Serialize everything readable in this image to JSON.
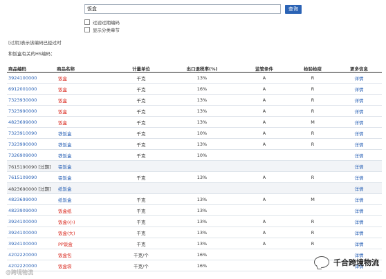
{
  "search": {
    "value": "饭盒",
    "button": "查询"
  },
  "options": [
    {
      "label": "过滤过期编码"
    },
    {
      "label": "显示分类章节"
    }
  ],
  "notes": {
    "expired_prefix": "[过期]",
    "expired_text": "表示该编码已经过时",
    "related": "和饭盒有关的HS编码："
  },
  "columns": [
    "商品编码",
    "商品名称",
    "计量单位",
    "出口退税率(%)",
    "监管条件",
    "检验检疫",
    "更多信息"
  ],
  "rows": [
    {
      "code": "3924100000",
      "name": "饭盒",
      "unit": "千克",
      "rate": "13%",
      "cond": "A",
      "insp": "R",
      "more": "详情",
      "name_color": "red",
      "code_link": true
    },
    {
      "code": "6912001000",
      "name": "饭盒",
      "unit": "千克",
      "rate": "16%",
      "cond": "A",
      "insp": "R",
      "more": "详情",
      "name_color": "red",
      "code_link": true
    },
    {
      "code": "7323930000",
      "name": "饭盒",
      "unit": "千克",
      "rate": "13%",
      "cond": "A",
      "insp": "R",
      "more": "详情",
      "name_color": "red",
      "code_link": true
    },
    {
      "code": "7323990000",
      "name": "饭盒",
      "unit": "千克",
      "rate": "13%",
      "cond": "A",
      "insp": "R",
      "more": "详情",
      "name_color": "red",
      "code_link": true
    },
    {
      "code": "4823699000",
      "name": "饭盒",
      "unit": "千克",
      "rate": "13%",
      "cond": "A",
      "insp": "M",
      "more": "详情",
      "name_color": "red",
      "code_link": true
    },
    {
      "code": "7323910090",
      "name": "铁饭盒",
      "unit": "千克",
      "rate": "10%",
      "cond": "A",
      "insp": "R",
      "more": "详情",
      "name_color": "blue",
      "code_link": true
    },
    {
      "code": "7323990000",
      "name": "铁饭盒",
      "unit": "千克",
      "rate": "13%",
      "cond": "A",
      "insp": "R",
      "more": "详情",
      "name_color": "blue",
      "code_link": true
    },
    {
      "code": "7326909000",
      "name": "铁饭盒",
      "unit": "千克",
      "rate": "10%",
      "cond": "",
      "insp": "",
      "more": "详情",
      "name_color": "blue",
      "code_link": true
    },
    {
      "code": "7615190090 [过期]",
      "name": "铝饭盒",
      "unit": "",
      "rate": "",
      "cond": "",
      "insp": "",
      "more": "详情",
      "name_color": "blue",
      "code_link": false
    },
    {
      "code": "7615109090",
      "name": "铝饭盒",
      "unit": "千克",
      "rate": "13%",
      "cond": "A",
      "insp": "R",
      "more": "详情",
      "name_color": "blue",
      "code_link": true
    },
    {
      "code": "4823690000 [过期]",
      "name": "纸饭盒",
      "unit": "",
      "rate": "",
      "cond": "",
      "insp": "",
      "more": "详情",
      "name_color": "blue",
      "code_link": false
    },
    {
      "code": "4823699000",
      "name": "纸饭盒",
      "unit": "千克",
      "rate": "13%",
      "cond": "A",
      "insp": "M",
      "more": "详情",
      "name_color": "blue",
      "code_link": true
    },
    {
      "code": "4823909000",
      "name": "饭盒纸",
      "unit": "千克",
      "rate": "13%",
      "cond": "",
      "insp": "",
      "more": "详情",
      "name_color": "red",
      "code_link": true
    },
    {
      "code": "3924100000",
      "name": "饭盒(小)",
      "unit": "千克",
      "rate": "13%",
      "cond": "A",
      "insp": "R",
      "more": "详情",
      "name_color": "red",
      "code_link": true
    },
    {
      "code": "3924100000",
      "name": "饭盒(大)",
      "unit": "千克",
      "rate": "13%",
      "cond": "A",
      "insp": "R",
      "more": "详情",
      "name_color": "red",
      "code_link": true
    },
    {
      "code": "3924100000",
      "name": "PP饭盒",
      "unit": "千克",
      "rate": "13%",
      "cond": "A",
      "insp": "R",
      "more": "详情",
      "name_color": "red",
      "code_link": true
    },
    {
      "code": "4202220000",
      "name": "饭盒包",
      "unit": "千克/个",
      "rate": "16%",
      "cond": "",
      "insp": "",
      "more": "详情",
      "name_color": "red",
      "code_link": true
    },
    {
      "code": "4202220000",
      "name": "饭盒袋",
      "unit": "千克/个",
      "rate": "16%",
      "cond": "",
      "insp": "",
      "more": "详情",
      "name_color": "red",
      "code_link": true
    }
  ],
  "watermark": {
    "text": "千合跨境物流",
    "icon": "chat-bubble-icon",
    "corner": "@跨境物流"
  }
}
